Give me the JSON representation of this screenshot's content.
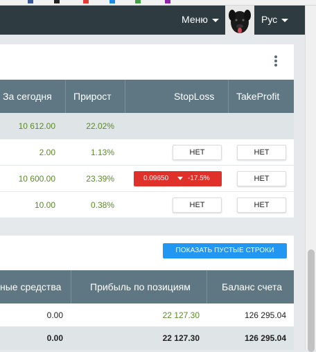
{
  "header": {
    "menu_label": "Меню",
    "lang_label": "Рус"
  },
  "positions_table": {
    "columns": [
      "За сегодня",
      "Прирост",
      "StopLoss",
      "TakeProfit"
    ],
    "summary": {
      "today": "10 612.00",
      "growth": "22.02%"
    },
    "rows": [
      {
        "today": "2.00",
        "growth": "1.13%",
        "stoploss": "НЕТ",
        "takeprofit": "НЕТ"
      },
      {
        "today": "10 600.00",
        "growth": "23.39%",
        "stoploss_value": "0.09650",
        "stoploss_pct": "-17.5%",
        "takeprofit": "НЕТ"
      },
      {
        "today": "10.00",
        "growth": "0.38%",
        "stoploss": "НЕТ",
        "takeprofit": "НЕТ"
      }
    ]
  },
  "balance_table": {
    "show_empty_button": "ПОКАЗАТЬ ПУСТЫЕ СТРОКИ",
    "columns": [
      "ные средства",
      "Прибыль по позициям",
      "Баланс счета"
    ],
    "rows": [
      {
        "funds": "0.00",
        "profit": "22 127.30",
        "balance": "126 295.04"
      }
    ],
    "total": {
      "funds": "0.00",
      "profit": "22 127.30",
      "balance": "126 295.04"
    }
  },
  "colors": {
    "header_bg": "#2e3b41",
    "table_header_bg": "#5f7782",
    "positive_green": "#5a8a28",
    "stoploss_red": "#e0302a",
    "button_blue": "#2196f3"
  },
  "icons": [
    "menu-caret-icon",
    "language-caret-icon",
    "kebab-menu-icon",
    "down-arrow-icon",
    "dog-avatar"
  ]
}
